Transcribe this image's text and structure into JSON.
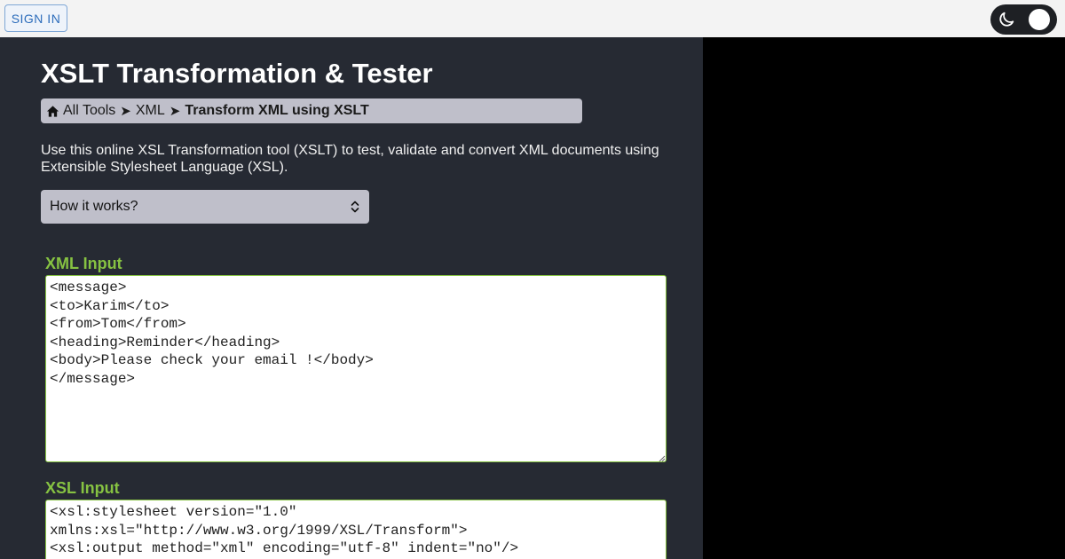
{
  "header": {
    "signin_label": "SIGN IN",
    "theme_toggle": {
      "icon": "moon-icon",
      "state": "on"
    }
  },
  "page": {
    "title": "XSLT Transformation & Tester",
    "breadcrumb": {
      "items": [
        "All Tools",
        "XML"
      ],
      "separator": "➤",
      "current": "Transform XML using XSLT"
    },
    "intro": "Use this online XSL Transformation tool (XSLT) to test, validate and convert XML documents using Extensible Stylesheet Language (XSL).",
    "how_it_works": "How it works?"
  },
  "xml_input": {
    "label": "XML Input",
    "value": "<message>\n<to>Karim</to>\n<from>Tom</from>\n<heading>Reminder</heading>\n<body>Please check your email !</body>\n</message>"
  },
  "xsl_input": {
    "label": "XSL Input",
    "value": "<xsl:stylesheet version=\"1.0\"\nxmlns:xsl=\"http://www.w3.org/1999/XSL/Transform\">\n<xsl:output method=\"xml\" encoding=\"utf-8\" indent=\"no\"/>"
  },
  "colors": {
    "accent": "#86c242",
    "main_bg": "#262a33",
    "link_blue": "#2d6dbb"
  }
}
